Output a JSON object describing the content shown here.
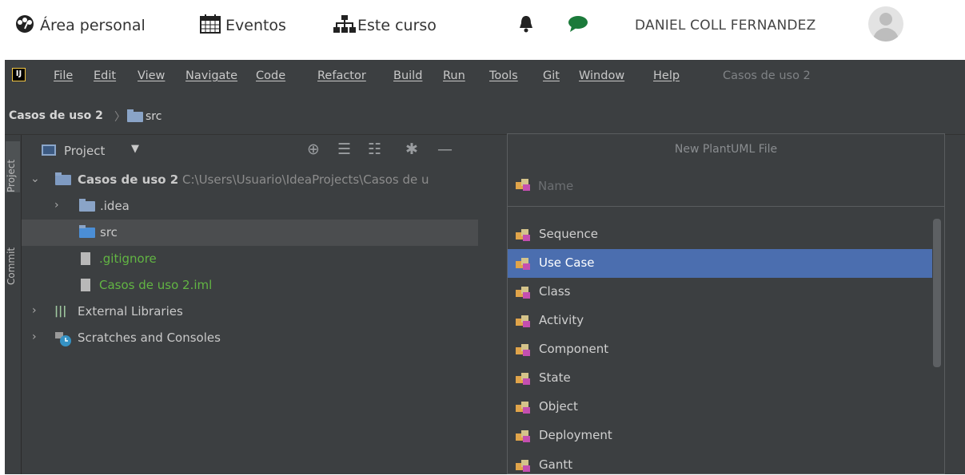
{
  "moodle": {
    "home_label": "Área personal",
    "events_label": "Eventos",
    "course_label": "Este curso",
    "user_name": "DANIEL COLL FERNANDEZ"
  },
  "ide": {
    "logo": "IJ",
    "menu": [
      "File",
      "Edit",
      "View",
      "Navigate",
      "Code",
      "Refactor",
      "Build",
      "Run",
      "Tools",
      "Git",
      "Window",
      "Help"
    ],
    "window_title": "Casos de uso 2",
    "breadcrumb": {
      "project": "Casos de uso 2",
      "folder": "src"
    },
    "side_tabs": {
      "project": "Project",
      "commit": "Commit"
    },
    "project_panel": {
      "title": "Project",
      "tree": {
        "root_name": "Casos de uso 2",
        "root_path": "C:\\Users\\Usuario\\IdeaProjects\\Casos de u",
        "idea": ".idea",
        "src": "src",
        "gitignore": ".gitignore",
        "iml": "Casos de uso 2.iml",
        "external": "External Libraries",
        "scratches": "Scratches and Consoles"
      }
    },
    "popup": {
      "title": "New PlantUML File",
      "name_placeholder": "Name",
      "items": [
        "Sequence",
        "Use Case",
        "Class",
        "Activity",
        "Component",
        "State",
        "Object",
        "Deployment",
        "Gantt"
      ],
      "selected": "Use Case"
    }
  },
  "colors": {
    "ide_bg": "#3c3f41",
    "selection": "#4b6eaf",
    "vcs_green": "#62b543"
  }
}
